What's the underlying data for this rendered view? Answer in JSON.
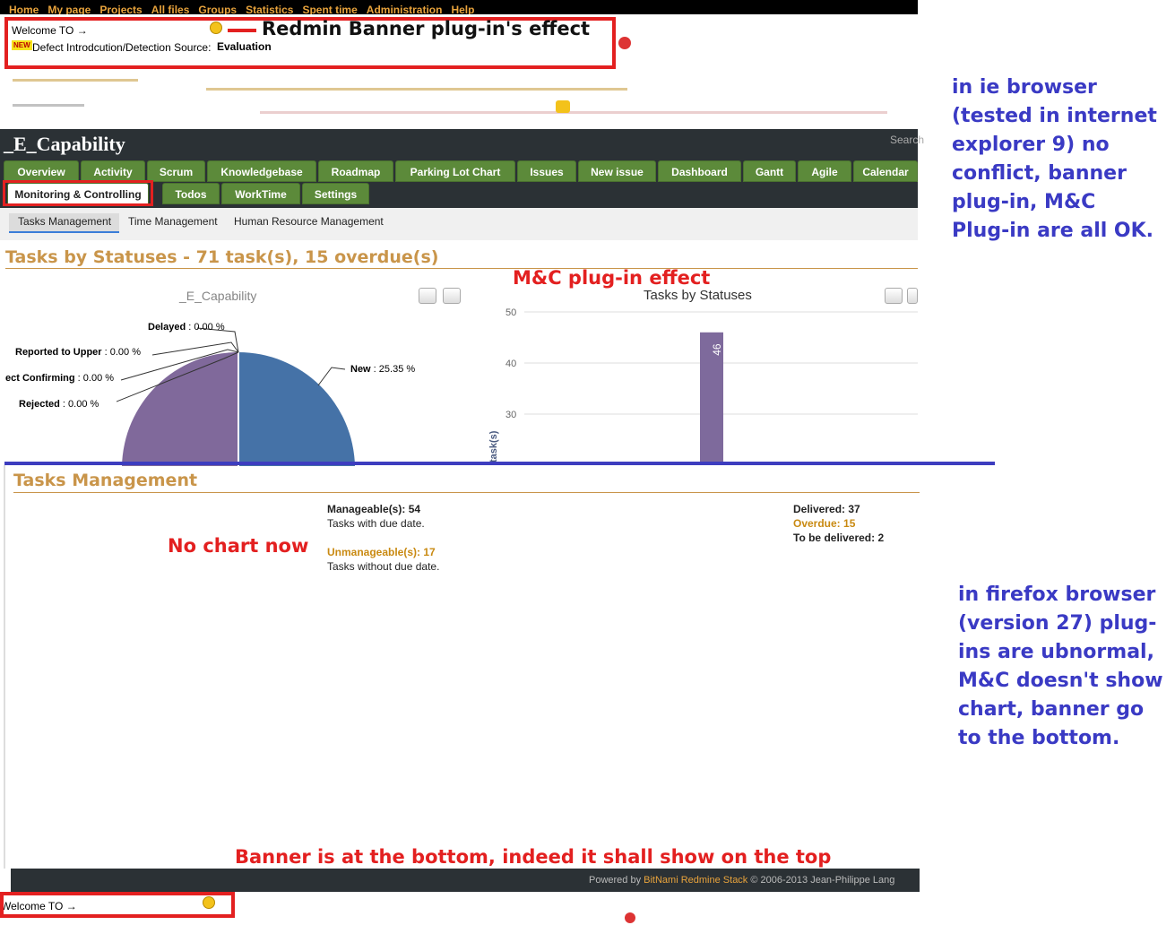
{
  "top_menu": [
    "Home",
    "My page",
    "Projects",
    "All files",
    "Groups",
    "Statistics",
    "Spent time",
    "Administration",
    "Help"
  ],
  "banner": {
    "welcome": "Welcome TO →",
    "defect_line": "Defect Introdcution/Detection Source:",
    "defect_value": "Evaluation",
    "new_badge": "NEW"
  },
  "annotations": {
    "banner_effect": "Redmin Banner plug-in's effect",
    "mc_effect": "M&C plug-in effect",
    "no_chart": "No chart now",
    "banner_bottom": "Banner is at the bottom, indeed it shall show on the top",
    "ie_note": [
      "in ie browser",
      "(tested in internet",
      "explorer 9) no",
      "conflict, banner",
      "plug-in, M&C",
      "Plug-in are all OK."
    ],
    "ff_note": [
      "in firefox browser",
      "(version 27) plug-",
      "ins are ubnormal,",
      "M&C doesn't show",
      "chart, banner go",
      "to the bottom."
    ]
  },
  "header": {
    "project_title": "_E_Capability",
    "search": "Search"
  },
  "tabs_row1": [
    "Overview",
    "Activity",
    "Scrum",
    "Knowledgebase",
    "Roadmap",
    "Parking Lot Chart",
    "Issues",
    "New issue",
    "Dashboard",
    "Gantt",
    "Agile",
    "Calendar"
  ],
  "tabs_row2": [
    "Monitoring & Controlling",
    "Todos",
    "WorkTime",
    "Settings"
  ],
  "subtabs": [
    "Tasks Management",
    "Time Management",
    "Human Resource Management"
  ],
  "tasks_by_status_title": "Tasks by Statuses - 71 task(s), 15 overdue(s)",
  "pie_chart": {
    "title": "_E_Capability",
    "labels": [
      {
        "name": "Delayed",
        "value": "0.00 %"
      },
      {
        "name": "Reported to Upper",
        "value": "0.00 %"
      },
      {
        "name": "ect Confirming",
        "value": "0.00 %"
      },
      {
        "name": "Rejected",
        "value": "0.00 %"
      },
      {
        "name": "New",
        "value": "25.35 %"
      }
    ]
  },
  "chart_data": {
    "type": "bar",
    "title": "Tasks by Statuses",
    "ylabel": "task(s)",
    "yticks": [
      "50",
      "40",
      "30"
    ],
    "ylim": [
      30,
      50
    ],
    "values": [
      46
    ],
    "data_label": "46",
    "colors": {
      "bar": "#7e6a9c"
    }
  },
  "tasks_mgmt": {
    "title": "Tasks Management",
    "manageable_label": "Manageable(s):",
    "manageable_value": "54",
    "manageable_desc": "Tasks with due date.",
    "unmanageable_label": "Unmanageable(s):",
    "unmanageable_value": "17",
    "unmanageable_desc": "Tasks without due date.",
    "delivered_label": "Delivered:",
    "delivered_value": "37",
    "overdue_label": "Overdue:",
    "overdue_value": "15",
    "tbd_label": "To be delivered:",
    "tbd_value": "2"
  },
  "footer": {
    "powered": "Powered by",
    "stack": "BitNami Redmine Stack",
    "copyright": "© 2006-2013 Jean-Philippe Lang"
  },
  "colors": {
    "tab_green": "#5c8a3a",
    "pie_blue": "#4572a7",
    "pie_purple": "#80699b",
    "annot_red": "#e32020",
    "annot_blue": "#3a3ac4"
  }
}
